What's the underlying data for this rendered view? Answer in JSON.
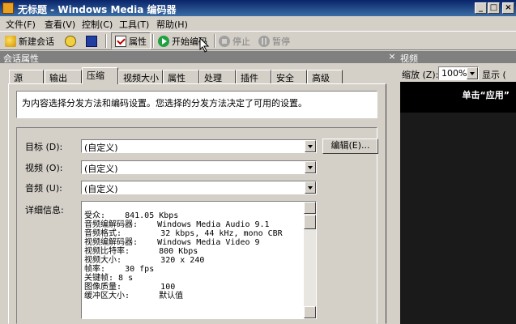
{
  "window": {
    "title": "无标题 - Windows Media 编码器",
    "controls": {
      "minimize": "_",
      "maximize": "□",
      "close": "×"
    }
  },
  "menu": [
    {
      "label": "文件(F)"
    },
    {
      "label": "查看(V)"
    },
    {
      "label": "控制(C)"
    },
    {
      "label": "工具(T)"
    },
    {
      "label": "帮助(H)"
    }
  ],
  "toolbar": {
    "new_session": "新建会话",
    "properties": "属性",
    "start_encoding": "开始编码",
    "stop": "停止",
    "pause": "暂停"
  },
  "session_panel": {
    "title": "会话属性",
    "close": "×",
    "tabs": [
      {
        "label": "源"
      },
      {
        "label": "输出"
      },
      {
        "label": "压缩",
        "active": true
      },
      {
        "label": "视频大小"
      },
      {
        "label": "属性"
      },
      {
        "label": "处理"
      },
      {
        "label": "插件"
      },
      {
        "label": "安全"
      },
      {
        "label": "高级"
      }
    ],
    "description": "为内容选择分发方法和编码设置。您选择的分发方法决定了可用的设置。",
    "target_label": "目标 (D):",
    "target_value": "(自定义)",
    "edit_button": "编辑(E)...",
    "video_label": "视频 (O):",
    "video_value": "(自定义)",
    "audio_label": "音频 (U):",
    "audio_value": "(自定义)",
    "details_label": "详细信息:",
    "details": [
      "受众:    841.05 Kbps",
      "音频编解码器:    Windows Media Audio 9.1",
      "音频格式:        32 kbps, 44 kHz, mono CBR",
      "视频编解码器:    Windows Media Video 9",
      "视频比特率:      800 Kbps",
      "视频大小:        320 x 240",
      "帧率:    30 fps",
      "关键帧: 8 s",
      "图像质量:        100",
      "缓冲区大小:      默认值"
    ]
  },
  "video_panel": {
    "title": "视频",
    "close": "×",
    "zoom_label": "缩放 (Z):",
    "zoom_value": "100%",
    "display_label": "显示 (",
    "overlay_text": "单击“应用”"
  },
  "colors": {
    "title_bar": "#0a246a",
    "panel_header": "#808080",
    "face": "#d4d0c8"
  }
}
